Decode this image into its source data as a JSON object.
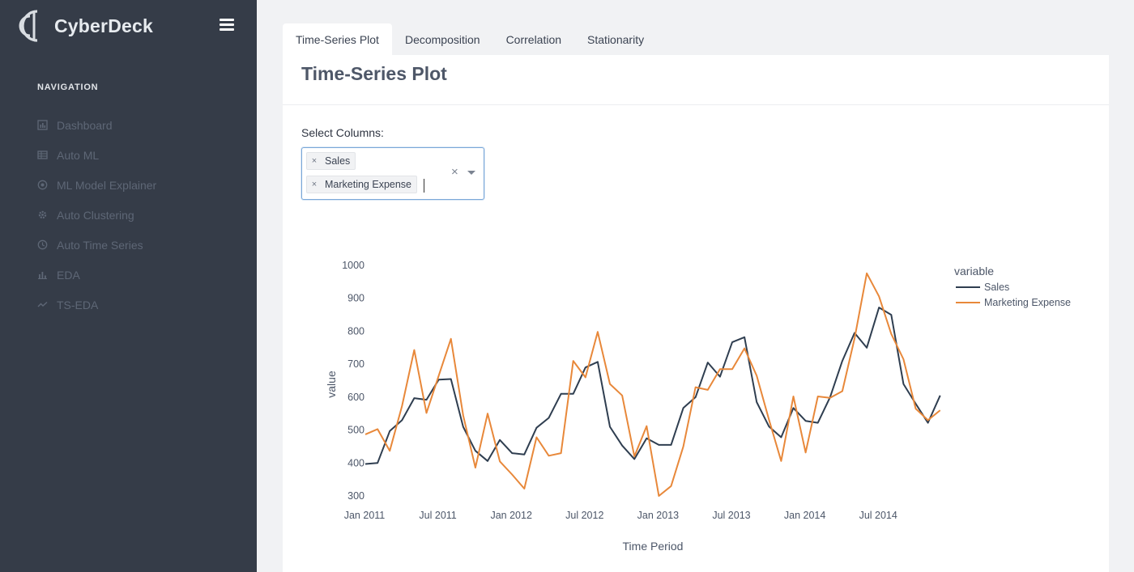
{
  "app": {
    "brand": "CyberDeck"
  },
  "sidebar": {
    "heading": "NAVIGATION",
    "items": [
      {
        "label": "Dashboard",
        "icon": "dashboard-icon"
      },
      {
        "label": "Auto ML",
        "icon": "grid-icon"
      },
      {
        "label": "ML Model Explainer",
        "icon": "globe-icon"
      },
      {
        "label": "Auto Clustering",
        "icon": "gear-icon"
      },
      {
        "label": "Auto Time Series",
        "icon": "clock-icon"
      },
      {
        "label": "EDA",
        "icon": "bar-chart-icon"
      },
      {
        "label": "TS-EDA",
        "icon": "line-chart-icon"
      }
    ]
  },
  "tabs": [
    {
      "label": "Time-Series Plot",
      "active": true
    },
    {
      "label": "Decomposition",
      "active": false
    },
    {
      "label": "Correlation",
      "active": false
    },
    {
      "label": "Stationarity",
      "active": false
    }
  ],
  "card": {
    "title": "Time-Series Plot",
    "select_label": "Select Columns:",
    "selected": [
      "Sales",
      "Marketing Expense"
    ],
    "chip_remove": "×",
    "clear_symbol": "×"
  },
  "colors": {
    "sidebar_bg": "#353c48",
    "sales": "#2f3e50",
    "marketing": "#e8883a"
  },
  "chart_data": {
    "type": "line",
    "xlabel": "Time Period",
    "ylabel": "value",
    "ylim": [
      300,
      1000
    ],
    "yticks": [
      300,
      400,
      500,
      600,
      700,
      800,
      900,
      1000
    ],
    "xticks": [
      "Jan 2011",
      "Jul 2011",
      "Jan 2012",
      "Jul 2012",
      "Jan 2013",
      "Jul 2013",
      "Jan 2014",
      "Jul 2014"
    ],
    "x_start": "Jan 2011",
    "x_frequency": "monthly",
    "legend_title": "variable",
    "legend_position": "top-right",
    "grid": false,
    "series": [
      {
        "name": "Sales",
        "values": [
          397,
          400,
          497,
          530,
          597,
          592,
          653,
          655,
          510,
          437,
          406,
          470,
          430,
          426,
          507,
          537,
          610,
          610,
          690,
          707,
          510,
          453,
          412,
          475,
          455,
          455,
          567,
          600,
          705,
          662,
          767,
          782,
          585,
          511,
          478,
          567,
          528,
          522,
          600,
          710,
          795,
          750,
          872,
          850,
          640,
          580,
          522,
          605
        ]
      },
      {
        "name": "Marketing Expense",
        "values": [
          487,
          503,
          437,
          573,
          743,
          552,
          665,
          777,
          545,
          386,
          550,
          405,
          365,
          322,
          478,
          422,
          430,
          710,
          660,
          798,
          640,
          605,
          420,
          512,
          300,
          330,
          450,
          630,
          622,
          685,
          685,
          748,
          665,
          532,
          406,
          602,
          432,
          602,
          598,
          618,
          778,
          976,
          906,
          792,
          715,
          565,
          530,
          560
        ]
      }
    ]
  }
}
